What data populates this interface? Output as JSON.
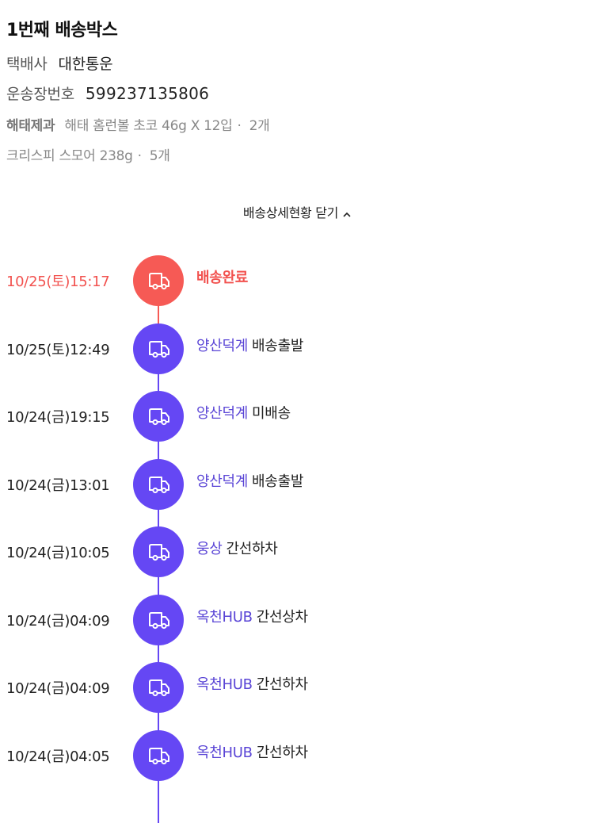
{
  "colors": {
    "accent_red": "#f65a55",
    "accent_purple": "#6547f4",
    "location_text": "#5a45d6"
  },
  "box": {
    "title": "1번째 배송박스",
    "courier_label": "택배사",
    "courier_value": "대한통운",
    "tracking_label": "운송장번호",
    "tracking_value": "599237135806"
  },
  "items": [
    {
      "brand": "해태제과",
      "name": "해태 홈런볼 초코 46g X 12입",
      "qty": "2개"
    },
    {
      "brand": "",
      "name": "크리스피 스모어 238g",
      "qty": "5개"
    }
  ],
  "toggle": {
    "label": "배송상세현황 닫기",
    "icon": "chevron-up-icon"
  },
  "timeline": {
    "icon": "truck-icon",
    "events": [
      {
        "time": "10/25(토)15:17",
        "location": "",
        "status": "배송완료",
        "state": "done"
      },
      {
        "time": "10/25(토)12:49",
        "location": "양산덕계",
        "status": "배송출발",
        "state": "past"
      },
      {
        "time": "10/24(금)19:15",
        "location": "양산덕계",
        "status": "미배송",
        "state": "past"
      },
      {
        "time": "10/24(금)13:01",
        "location": "양산덕계",
        "status": "배송출발",
        "state": "past"
      },
      {
        "time": "10/24(금)10:05",
        "location": "웅상",
        "status": "간선하차",
        "state": "past"
      },
      {
        "time": "10/24(금)04:09",
        "location": "옥천HUB",
        "status": "간선상차",
        "state": "past"
      },
      {
        "time": "10/24(금)04:09",
        "location": "옥천HUB",
        "status": "간선하차",
        "state": "past"
      },
      {
        "time": "10/24(금)04:05",
        "location": "옥천HUB",
        "status": "간선하차",
        "state": "past"
      }
    ]
  }
}
